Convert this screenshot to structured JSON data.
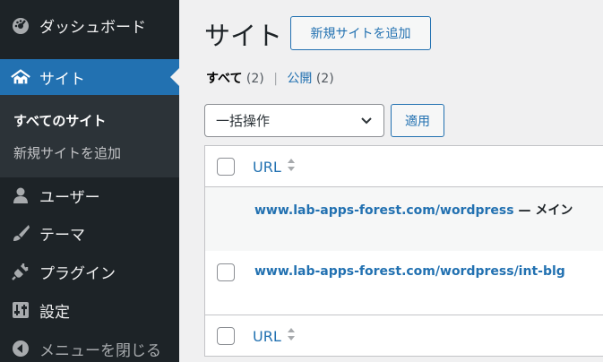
{
  "sidebar": {
    "dashboard": "ダッシュボード",
    "sites": "サイト",
    "submenu": {
      "all_sites": "すべてのサイト",
      "add_new": "新規サイトを追加"
    },
    "users": "ユーザー",
    "themes": "テーマ",
    "plugins": "プラグイン",
    "settings": "設定",
    "collapse": "メニューを閉じる"
  },
  "header": {
    "title": "サイト",
    "add_new_button": "新規サイトを追加"
  },
  "filters": {
    "all_label": "すべて",
    "all_count": "(2)",
    "public_label": "公開",
    "public_count": "(2)",
    "separator": "|"
  },
  "bulk": {
    "select_value": "一括操作",
    "apply_button": "適用"
  },
  "table": {
    "column_url": "URL",
    "rows": [
      {
        "url": "www.lab-apps-forest.com/wordpress",
        "suffix": " — メイン"
      },
      {
        "url": "www.lab-apps-forest.com/wordpress/int-blg",
        "suffix": ""
      }
    ]
  },
  "colors": {
    "sidebar_bg": "#1d2327",
    "accent": "#2271b1",
    "page_bg": "#f0f0f1"
  }
}
